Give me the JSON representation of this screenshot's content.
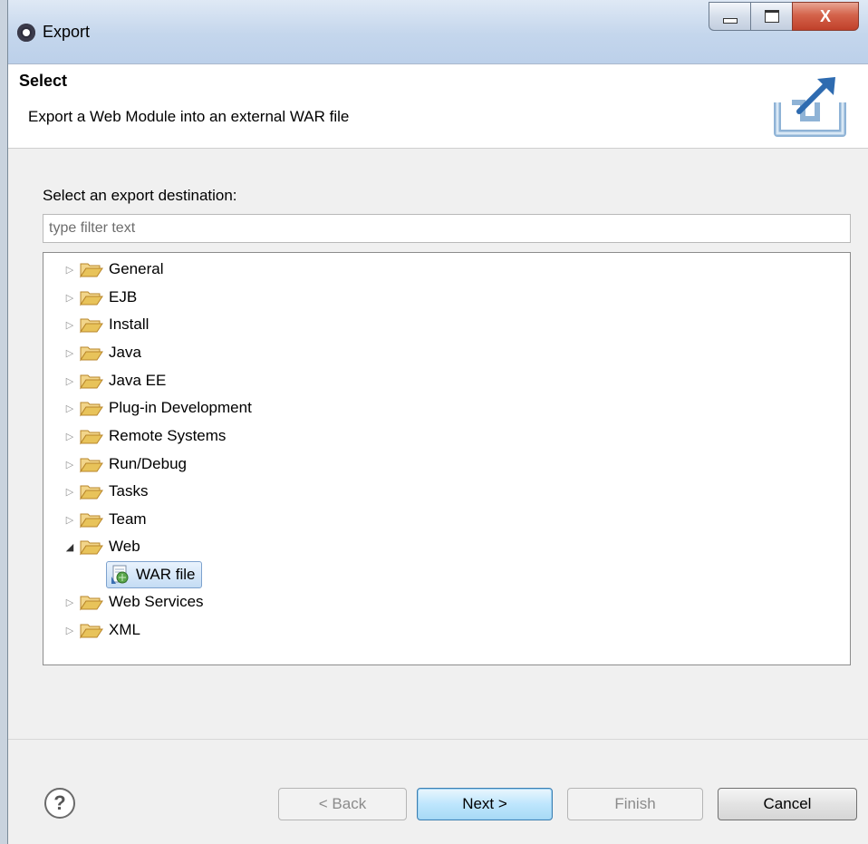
{
  "window": {
    "title": "Export",
    "close_glyph": "X"
  },
  "header": {
    "title": "Select",
    "description": "Export a Web Module into an external WAR file",
    "icon": "export-icon"
  },
  "filter": {
    "label": "Select an export destination:",
    "placeholder": "type filter text",
    "value": ""
  },
  "tree": {
    "items": [
      {
        "label": "General",
        "expanded": false
      },
      {
        "label": "EJB",
        "expanded": false
      },
      {
        "label": "Install",
        "expanded": false
      },
      {
        "label": "Java",
        "expanded": false
      },
      {
        "label": "Java EE",
        "expanded": false
      },
      {
        "label": "Plug-in Development",
        "expanded": false
      },
      {
        "label": "Remote Systems",
        "expanded": false
      },
      {
        "label": "Run/Debug",
        "expanded": false
      },
      {
        "label": "Tasks",
        "expanded": false
      },
      {
        "label": "Team",
        "expanded": false
      },
      {
        "label": "Web",
        "expanded": true
      },
      {
        "label": "WAR file",
        "child": true,
        "selected": true
      },
      {
        "label": "Web Services",
        "expanded": false
      },
      {
        "label": "XML",
        "expanded": false
      }
    ]
  },
  "footer": {
    "help_glyph": "?",
    "back_label": "< Back",
    "next_label": "Next >",
    "finish_label": "Finish",
    "cancel_label": "Cancel"
  },
  "colors": {
    "folder": "#e8c35a",
    "selection": "#c4dcf4",
    "default_button": "#a7d9f5"
  }
}
